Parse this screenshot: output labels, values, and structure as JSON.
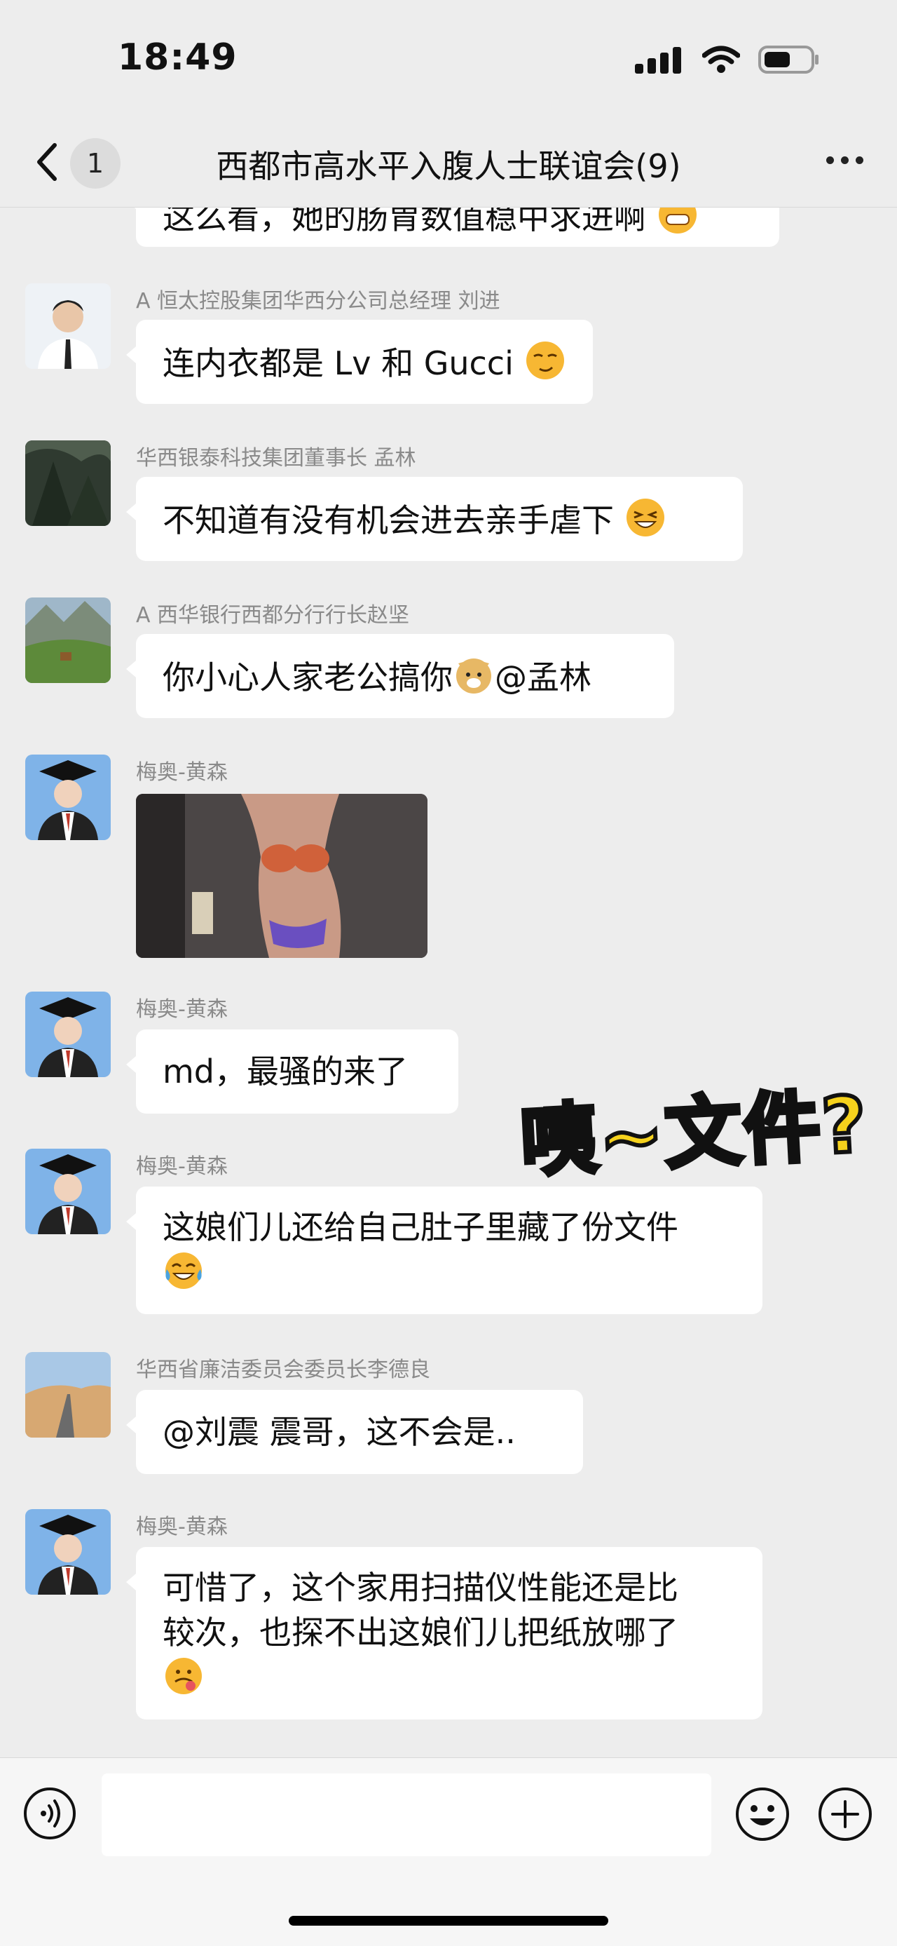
{
  "status": {
    "time": "18:49"
  },
  "header": {
    "unread_count": "1",
    "title": "西都市高水平入腹人士联谊会(9)"
  },
  "messages": [
    {
      "text": "这么看，她的肠胃数值稳中求进啊"
    },
    {
      "sender": "A 恒太控股集团华西分公司总经理 刘进",
      "text": "连内衣都是 Lv 和 Gucci"
    },
    {
      "sender": "华西银泰科技集团董事长 孟林",
      "text": "不知道有没有机会进去亲手虐下"
    },
    {
      "sender": "A 西华银行西都分行行长赵坚",
      "text": "你小心人家老公搞你",
      "mention": "@孟林"
    },
    {
      "sender": "梅奥-黄森",
      "image": "x-ray-body-photo"
    },
    {
      "sender": "梅奥-黄森",
      "text": "md，最骚的来了"
    },
    {
      "sender": "梅奥-黄森",
      "text": "这娘们儿还给自己肚子里藏了份文件"
    },
    {
      "sender": "华西省廉洁委员会委员长李德良",
      "text": "@刘震 震哥，这不会是.."
    },
    {
      "sender": "梅奥-黄森",
      "text_line1": "可惜了，这个家用扫描仪性能还是比",
      "text_line2": "较次，也探不出这娘们儿把纸放哪了"
    }
  ],
  "overlay": {
    "text": "咦~文件?"
  },
  "colors": {
    "background": "#ededed",
    "bubble": "#ffffff",
    "sender": "#8a8a8a",
    "overlay": "#f6d21c"
  }
}
